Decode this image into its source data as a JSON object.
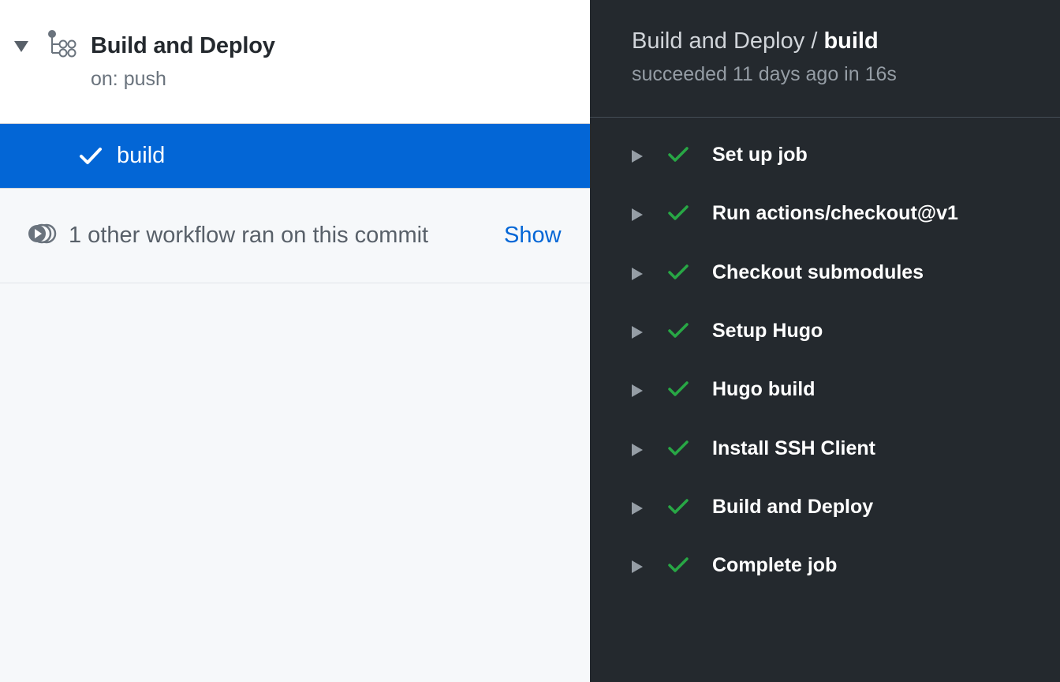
{
  "workflow": {
    "title": "Build and Deploy",
    "trigger": "on: push"
  },
  "job": {
    "name": "build",
    "status": "success"
  },
  "other_workflows": {
    "text": "1 other workflow ran on this commit",
    "show_label": "Show"
  },
  "log": {
    "workflow_name": "Build and Deploy",
    "separator": " / ",
    "job_name": "build",
    "summary": "succeeded 11 days ago in 16s"
  },
  "steps": [
    {
      "label": "Set up job",
      "status": "success"
    },
    {
      "label": "Run actions/checkout@v1",
      "status": "success"
    },
    {
      "label": "Checkout submodules",
      "status": "success"
    },
    {
      "label": "Setup Hugo",
      "status": "success"
    },
    {
      "label": "Hugo build",
      "status": "success"
    },
    {
      "label": "Install SSH Client",
      "status": "success"
    },
    {
      "label": "Build and Deploy",
      "status": "success"
    },
    {
      "label": "Complete job",
      "status": "success"
    }
  ],
  "colors": {
    "accent": "#0366d6",
    "success": "#28a745",
    "dark_bg": "#24292e"
  },
  "icons": {
    "collapse": "triangle-down-icon",
    "workflow": "workflow-icon",
    "job_status": "check-icon",
    "other_workflows": "play-stack-icon",
    "step_expand": "triangle-right-icon",
    "step_status": "check-icon"
  }
}
